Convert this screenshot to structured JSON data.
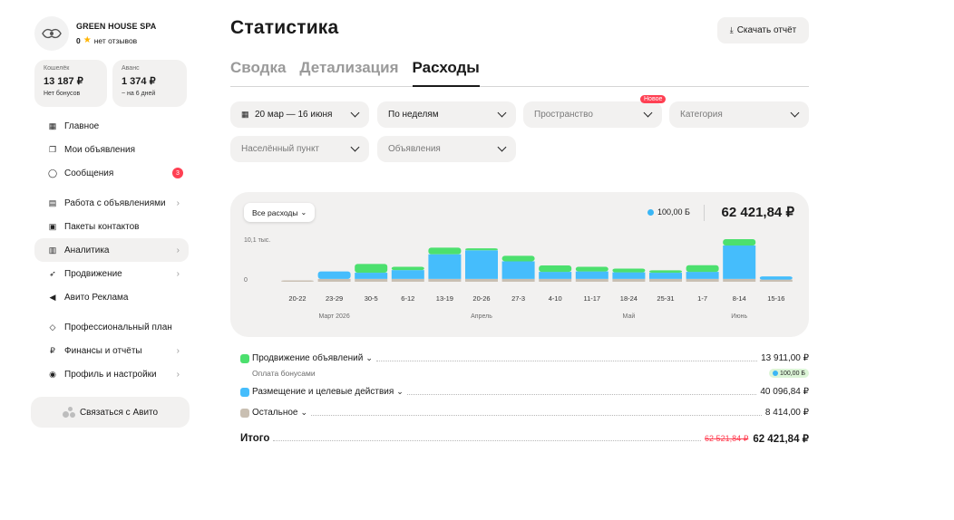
{
  "profile": {
    "name": "GREEN HOUSE SPA",
    "rating": "0",
    "reviews": "нет отзывов"
  },
  "wallet": {
    "caption": "Кошелёк",
    "value": "13 187 ₽",
    "sub": "Нет бонусов"
  },
  "advance": {
    "caption": "Аванс",
    "value": "1 374 ₽",
    "sub": "~ на 6 дней"
  },
  "nav": [
    {
      "label": "Главное",
      "icon": "grid-icon"
    },
    {
      "label": "Мои объявления",
      "icon": "listings-icon"
    },
    {
      "label": "Сообщения",
      "icon": "chat-icon",
      "badge": "3"
    },
    {
      "label": "Работа с объявлениями",
      "icon": "tools-icon"
    },
    {
      "label": "Пакеты контактов",
      "icon": "contacts-icon"
    },
    {
      "label": "Аналитика",
      "icon": "analytics-icon"
    },
    {
      "label": "Продвижение",
      "icon": "rocket-icon"
    },
    {
      "label": "Авито Реклама",
      "icon": "megaphone-icon"
    },
    {
      "label": "Профессиональный план",
      "icon": "diamond-icon"
    },
    {
      "label": "Финансы и отчёты",
      "icon": "ruble-icon"
    },
    {
      "label": "Профиль и настройки",
      "icon": "user-icon"
    }
  ],
  "contact_button": "Связаться с Авито",
  "page_title": "Статистика",
  "download_button": "Скачать отчёт",
  "tabs": [
    "Сводка",
    "Детализация",
    "Расходы"
  ],
  "filters": {
    "period": "20 мар — 16 июня",
    "grouping": "По неделям",
    "space": "Пространство",
    "space_badge": "Новое",
    "category": "Категория",
    "locality": "Населённый пункт",
    "ads": "Объявления"
  },
  "chart_header": {
    "selector": "Все расходы",
    "bonus": "100,00 Б",
    "total": "62 421,84 ₽"
  },
  "chart_data": {
    "type": "bar",
    "stacked": true,
    "categories": [
      "20-22",
      "23-29",
      "30-5",
      "6-12",
      "13-19",
      "20-26",
      "27-3",
      "4-10",
      "11-17",
      "18-24",
      "25-31",
      "1-7",
      "8-14",
      "15-16"
    ],
    "month_labels": [
      "Март 2026",
      "Апрель",
      "Май",
      "Июнь"
    ],
    "y_tick_labels": [
      "10,1 тыс.",
      "0"
    ],
    "ylim": [
      0,
      10100
    ],
    "series": [
      {
        "name": "Остальное",
        "color": "#c9bfb2",
        "values": [
          80,
          650,
          650,
          650,
          650,
          650,
          650,
          650,
          650,
          650,
          650,
          650,
          650,
          500
        ]
      },
      {
        "name": "Размещение и целевые действия",
        "color": "#45bdfc",
        "values": [
          0,
          1700,
          1400,
          2000,
          5600,
          6500,
          4000,
          1600,
          1700,
          1500,
          1400,
          1600,
          7600,
          700
        ]
      },
      {
        "name": "Продвижение объявлений",
        "color": "#4ce06e",
        "values": [
          0,
          0,
          2000,
          750,
          1500,
          450,
          1250,
          1450,
          1050,
          850,
          550,
          1500,
          1450,
          0
        ]
      }
    ]
  },
  "breakdown": {
    "promotion": {
      "label": "Продвижение объявлений",
      "value": "13 911,00 ₽",
      "sub_label": "Оплата бонусами",
      "sub_value": "100,00 Б"
    },
    "placement": {
      "label": "Размещение и целевые действия",
      "value": "40 096,84 ₽"
    },
    "other": {
      "label": "Остальное",
      "value": "8 414,00 ₽"
    },
    "total": {
      "label": "Итого",
      "old_value": "62 521,84 ₽",
      "value": "62 421,84 ₽"
    }
  },
  "colors": {
    "promotion": "#4ce06e",
    "placement": "#45bdfc",
    "other": "#c9bfb2",
    "badge": "#ff4053"
  }
}
